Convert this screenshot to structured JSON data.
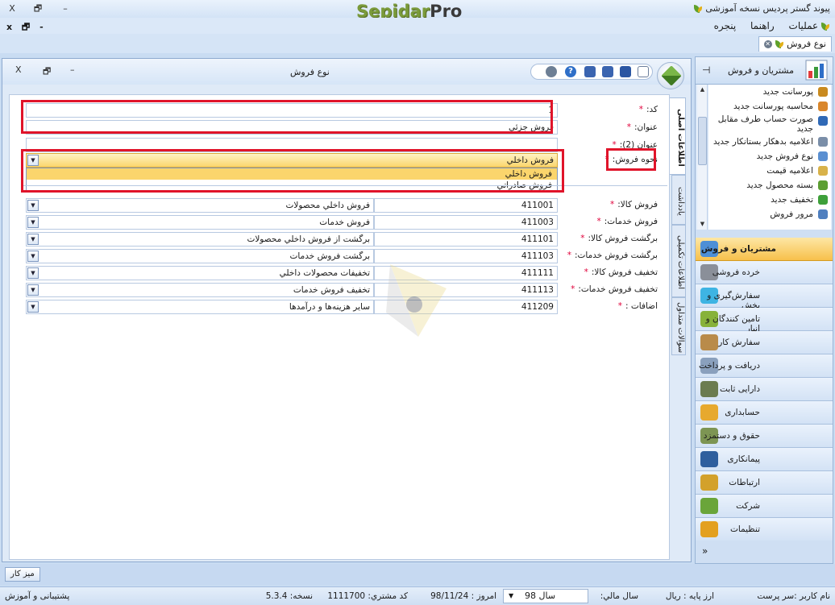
{
  "app": {
    "title": "پیوند گستر پردیس نسخه آموزشی",
    "logo_main": "Sepidar",
    "logo_pro": "Pro",
    "close": "X",
    "restore": "🗗",
    "minimize": "–"
  },
  "menu": {
    "items": [
      "عملیات",
      "راهنما",
      "پنجره"
    ],
    "mdi_controls": "x 🗗 -"
  },
  "doc_tab": {
    "label": "نوع فروش"
  },
  "window": {
    "title": "نوع فروش",
    "close": "X",
    "restore": "🗗",
    "minimize": "–"
  },
  "tabs": [
    "اطلاعات اصلی",
    "یادداشت",
    "اطلاعات تکمیلی",
    "سوالات متداول"
  ],
  "form": {
    "code": {
      "label": "کد:",
      "value": "1"
    },
    "title": {
      "label": "عنوان:",
      "value": "فروش جزئي"
    },
    "title2": {
      "label": "عنوان (2):",
      "value": ""
    },
    "sale_method": {
      "label": "نحوه فروش:",
      "value": "فروش داخلي",
      "options": [
        "فروش داخلي",
        "فروش صادراتي"
      ]
    },
    "accounts": [
      {
        "label": "فروش کالا:",
        "code": "411001",
        "name": "فروش  داخلي محصولات"
      },
      {
        "label": "فروش خدمات:",
        "code": "411003",
        "name": "فروش خدمات"
      },
      {
        "label": "برگشت فروش کالا:",
        "code": "411101",
        "name": "برگشت از فروش  داخلي محصولات"
      },
      {
        "label": "برگشت فروش خدمات:",
        "code": "411103",
        "name": "برگشت فروش خدمات"
      },
      {
        "label": "تخفيف فروش کالا:",
        "code": "411111",
        "name": "تخفيفات محصولات داخلي"
      },
      {
        "label": "تخفيف فروش خدمات:",
        "code": "411113",
        "name": "تخفيف فروش خدمات"
      },
      {
        "label": "اضافات :",
        "code": "411209",
        "name": "ساير هزينه‌ها و درآمدها"
      }
    ]
  },
  "nav": {
    "header": "مشتریان و فروش",
    "list": [
      {
        "label": "پورسانت جدید",
        "icon": "commission-icon",
        "color": "#c98a1f"
      },
      {
        "label": "محاسبه پورسانت جدید",
        "icon": "calc-commission-icon",
        "color": "#d9862b"
      },
      {
        "label": "صورت حساب طرف مقابل جدید",
        "icon": "statement-icon",
        "color": "#3069b6"
      },
      {
        "label": "اعلامیه بدهکار بستانکار جدید",
        "icon": "debit-credit-icon",
        "color": "#7a8ea8"
      },
      {
        "label": "نوع فروش جدید",
        "icon": "sale-type-icon",
        "color": "#5a8fd1"
      },
      {
        "label": "اعلامیه قیمت",
        "icon": "price-notice-icon",
        "color": "#d8b24a"
      },
      {
        "label": "بسته محصول جدید",
        "icon": "product-pack-icon",
        "color": "#5c9e32"
      },
      {
        "label": "تخفیف جدید",
        "icon": "discount-icon",
        "color": "#3ea03a"
      },
      {
        "label": "مرور فروش",
        "icon": "sales-review-icon",
        "color": "#4f7fbf"
      }
    ],
    "modules": [
      {
        "label": "مشتریان و فروش",
        "active": true,
        "color": "#4d8fd6"
      },
      {
        "label": "خرده فروشی",
        "color": "#8a8f99"
      },
      {
        "label": "سفارش‌گیری و پخش",
        "color": "#3eb4e3"
      },
      {
        "label": "تامین کنندگان و انبار",
        "color": "#87b23a"
      },
      {
        "label": "سفارش کار",
        "color": "#b98b4a"
      },
      {
        "label": "دریافت و پرداخت",
        "color": "#8aa0bd"
      },
      {
        "label": "دارایی ثابت",
        "color": "#6b7c50"
      },
      {
        "label": "حسابداری",
        "color": "#e7a92e"
      },
      {
        "label": "حقوق و دستمزد",
        "color": "#7d9553"
      },
      {
        "label": "پیمانکاری",
        "color": "#2f5f9e"
      },
      {
        "label": "ارتباطات",
        "color": "#d3a12b"
      },
      {
        "label": "شرکت",
        "color": "#6aa53a"
      },
      {
        "label": "تنظیمات",
        "color": "#e3a020"
      }
    ],
    "more": "»"
  },
  "bottom": {
    "desk": "میز کار",
    "user": "نام کاربر :سر پرست",
    "base_currency": "ارز پایه :  ريال",
    "fiscal_year_label": "سال مالي:",
    "fiscal_year": "سال 98",
    "today": "امروز :  98/11/24",
    "customer_code": "کد مشتري:  1111700",
    "version": "نسخه:  5.3.4",
    "support": "پشتیبانی و آموزش"
  }
}
